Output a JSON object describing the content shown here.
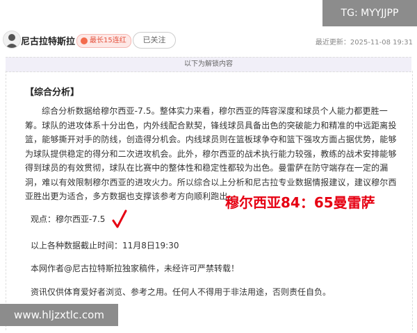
{
  "header": {
    "author_name": "尼古拉特斯拉",
    "badge_label": "最长15连红",
    "follow_label": "已关注",
    "last_updated": "最近更新：2025-11-08 19:31"
  },
  "content": {
    "unlock_notice": "以下为解锁内容",
    "section_title": "【综合分析】",
    "analysis": "综合分析数据给穆尔西亚-7.5。整体实力来看，穆尔西亚的阵容深度和球员个人能力都更胜一筹。球队的进攻体系十分出色，内外线配合默契，锋线球员具备出色的突破能力和精准的中远距离投篮，能够撕开对手的防线，创造得分机会。内线球员则在篮板球争夺和篮下强攻方面占据优势，能够为球队提供稳定的得分和二次进攻机会。此外，穆尔西亚的战术执行能力较强，教练的战术安排能够得到球员的有效贯彻，球队在比赛中的整体性和稳定性都较为出色。曼雷萨在防守端存在一定的漏洞，难以有效限制穆尔西亚的进攻火力。所以综合以上分析和尼古拉专业数据情报建议，建议穆尔西亚胜出更为适合，多方数据也支撑该参考方向顺利跑出。",
    "score_prediction": "穆尔西亚84：65曼雷萨",
    "viewpoint": "观点：穆尔西亚-7.5",
    "data_cutoff": "以上各种数据截止时间：11月8日19:30",
    "copyright": "本网作者@尼古拉特斯拉独家稿件，未经许可严禁转载！",
    "disclaimer": "资讯仅供体育爱好者浏览、参考之用。任何人不得用于非法用途，否则责任自负。"
  },
  "watermarks": {
    "top": "TG: MYYJJPP",
    "bottom": "www.hljzxtlc.com"
  },
  "colors": {
    "score_red": "#e60012",
    "badge_text": "#e4533f",
    "unlock_bg": "#f1eff8",
    "watermark_bg": "#8c8c8c"
  }
}
